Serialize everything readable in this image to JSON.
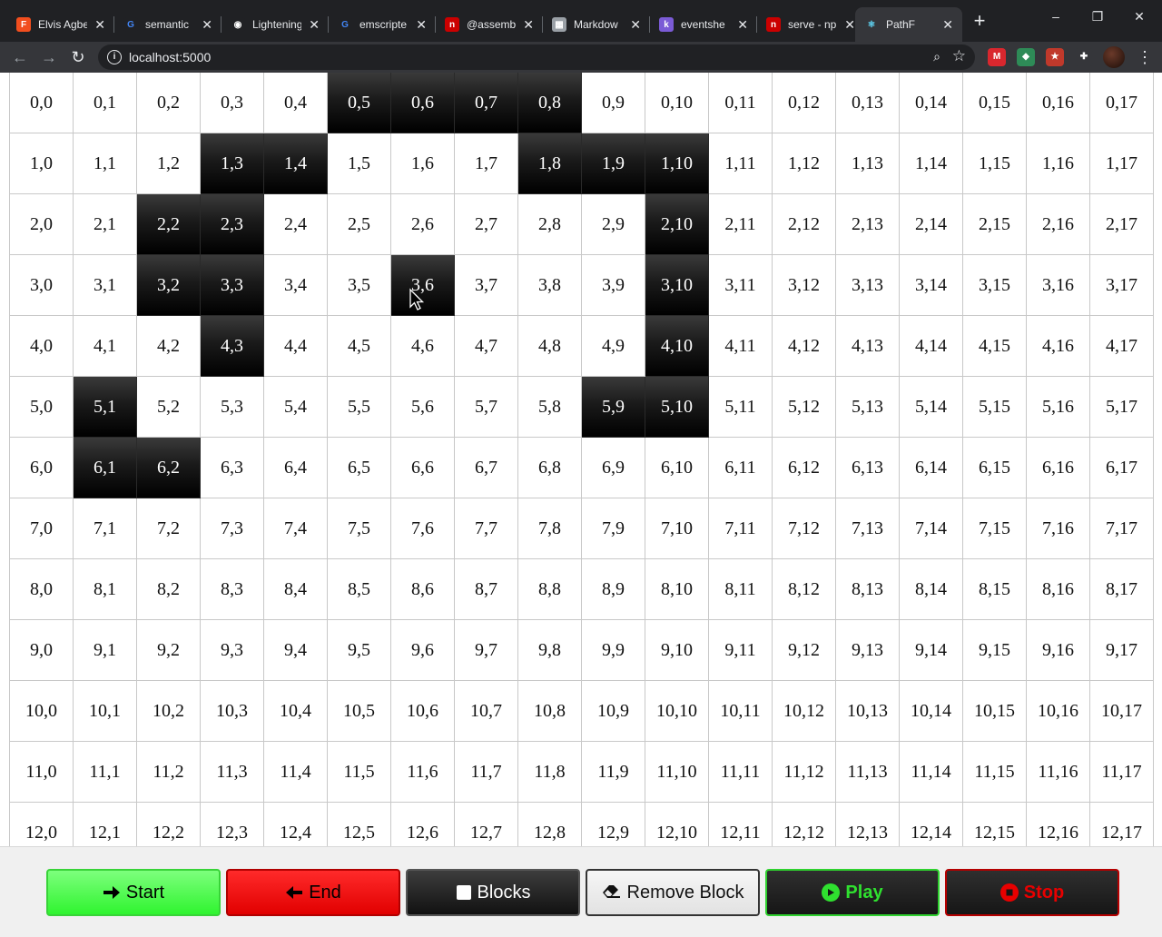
{
  "browser": {
    "tabs": [
      {
        "title": "Elvis Agbe",
        "icon": "figma-icon",
        "color": "#f24e1e",
        "glyph": "F"
      },
      {
        "title": "semantic",
        "icon": "google-icon",
        "color": "#ffffff",
        "glyph": "G"
      },
      {
        "title": "Lightening",
        "icon": "github-icon",
        "color": "#ffffff",
        "glyph": "◉"
      },
      {
        "title": "emscripte",
        "icon": "google-icon",
        "color": "#ffffff",
        "glyph": "G"
      },
      {
        "title": "@assemb",
        "icon": "npm-icon",
        "color": "#cb0000",
        "glyph": "n"
      },
      {
        "title": "Markdow",
        "icon": "doc-icon",
        "color": "#9aa0a6",
        "glyph": "▦"
      },
      {
        "title": "eventshe",
        "icon": "purple-k-icon",
        "color": "#7b5bd6",
        "glyph": "k"
      },
      {
        "title": "serve - np",
        "icon": "npm-icon",
        "color": "#cb0000",
        "glyph": "n"
      },
      {
        "title": "PathF",
        "icon": "react-icon",
        "color": "#61dafb",
        "glyph": "⚛"
      }
    ],
    "new_tab": "+",
    "window_controls": [
      "–",
      "❐",
      "✕"
    ],
    "url": "localhost:5000",
    "extensions": [
      {
        "name": "mega-extension-icon",
        "color": "#d9272e",
        "glyph": "M"
      },
      {
        "name": "green-extension-icon",
        "color": "#2e8b57",
        "glyph": "◆"
      },
      {
        "name": "santa-extension-icon",
        "color": "#c0392b",
        "glyph": "★"
      },
      {
        "name": "puzzle-extension-icon",
        "color": "#35363a",
        "glyph": "✚"
      }
    ]
  },
  "grid": {
    "rows_visible": 13,
    "cols": 18,
    "blocks": [
      "0,5",
      "0,6",
      "0,7",
      "0,8",
      "1,3",
      "1,4",
      "1,8",
      "1,9",
      "1,10",
      "2,2",
      "2,3",
      "2,10",
      "3,2",
      "3,3",
      "3,6",
      "3,10",
      "4,3",
      "4,10",
      "5,1",
      "5,9",
      "5,10",
      "6,1",
      "6,2"
    ]
  },
  "controls": {
    "start": {
      "label": "Start",
      "icon": "arrow-right-icon"
    },
    "end": {
      "label": "End",
      "icon": "arrow-left-icon"
    },
    "blocks": {
      "label": "Blocks",
      "icon": "square-icon"
    },
    "remove_block": {
      "label": "Remove Block",
      "icon": "eraser-icon"
    },
    "play": {
      "label": "Play",
      "icon": "play-circle-icon"
    },
    "stop": {
      "label": "Stop",
      "icon": "stop-circle-icon"
    }
  },
  "colors": {
    "start_green": "#2ff42f",
    "end_red": "#e10000",
    "block_black": "#000000",
    "play_green": "#2fe02f",
    "stop_red": "#e80000"
  }
}
